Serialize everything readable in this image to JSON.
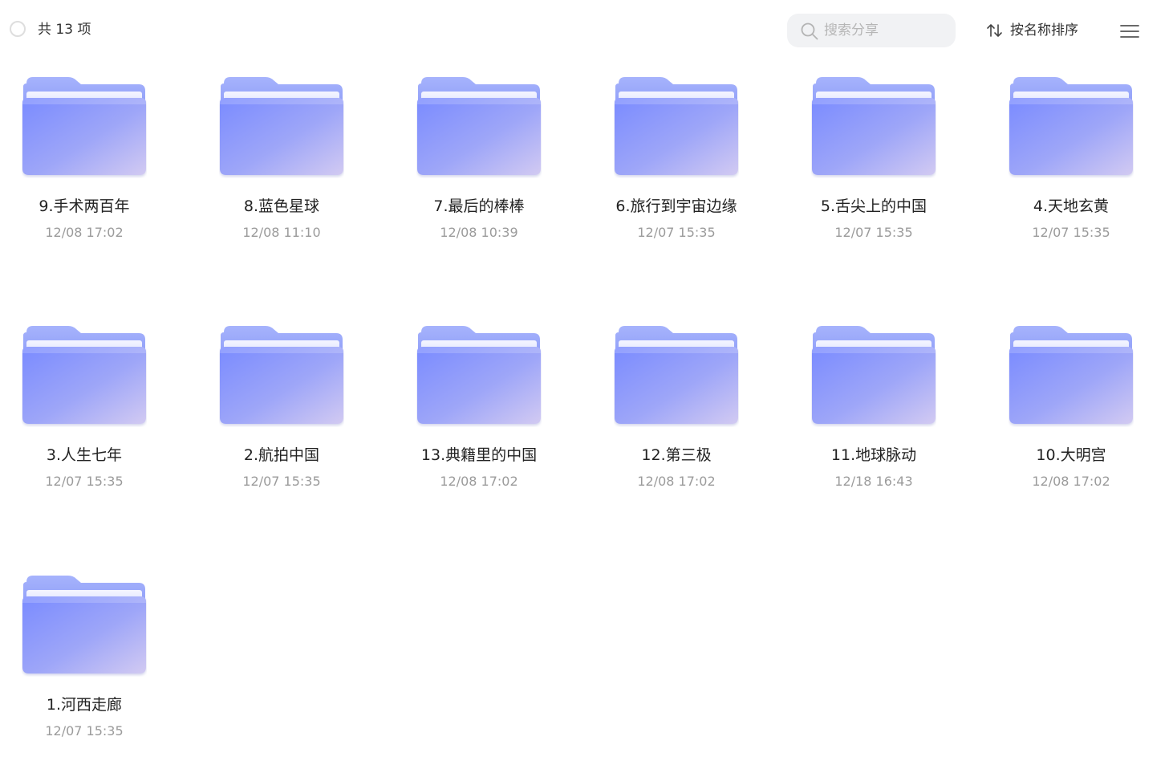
{
  "toolbar": {
    "count_label": "共 13 项",
    "search_placeholder": "搜索分享",
    "sort_label": "按名称排序"
  },
  "folders": [
    {
      "name": "9.手术两百年",
      "time": "12/08 17:02"
    },
    {
      "name": "8.蓝色星球",
      "time": "12/08 11:10"
    },
    {
      "name": "7.最后的棒棒",
      "time": "12/08 10:39"
    },
    {
      "name": "6.旅行到宇宙边缘",
      "time": "12/07 15:35"
    },
    {
      "name": "5.舌尖上的中国",
      "time": "12/07 15:35"
    },
    {
      "name": "4.天地玄黄",
      "time": "12/07 15:35"
    },
    {
      "name": "3.人生七年",
      "time": "12/07 15:35"
    },
    {
      "name": "2.航拍中国",
      "time": "12/07 15:35"
    },
    {
      "name": "13.典籍里的中国",
      "time": "12/08 17:02"
    },
    {
      "name": "12.第三极",
      "time": "12/08 17:02"
    },
    {
      "name": "11.地球脉动",
      "time": "12/18 16:43"
    },
    {
      "name": "10.大明宫",
      "time": "12/08 17:02"
    },
    {
      "name": "1.河西走廊",
      "time": "12/07 15:35"
    }
  ],
  "colors": {
    "folder_back": "#9aa8fb",
    "folder_front_start": "#7b8cff",
    "folder_front_end": "#cdc6f3"
  },
  "icons": {
    "select": "circle-outline-icon",
    "search": "search-icon",
    "sort": "sort-arrows-icon",
    "menu": "hamburger-menu-icon",
    "folder": "folder-icon"
  }
}
